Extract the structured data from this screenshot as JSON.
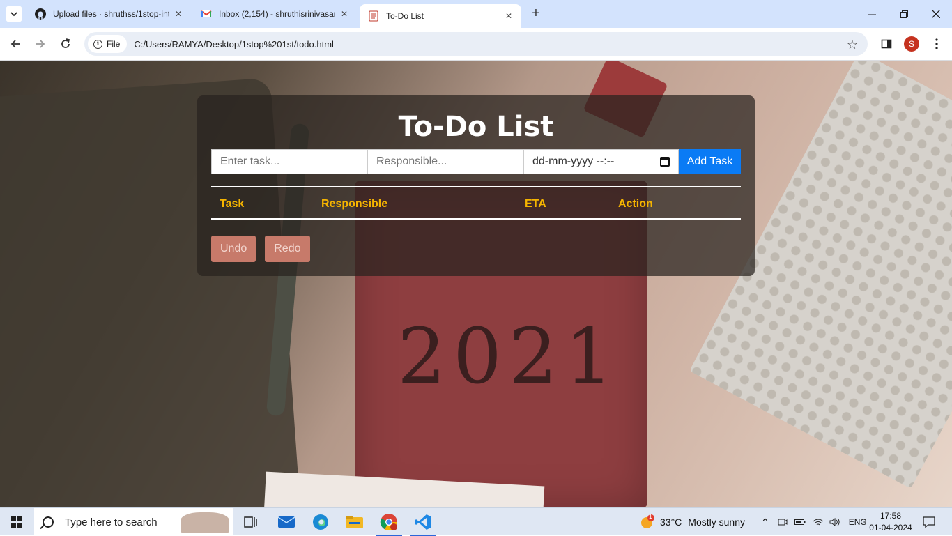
{
  "browser": {
    "tabs": [
      {
        "title": "Upload files · shruthss/1stop-int",
        "icon": "github-icon",
        "active": false
      },
      {
        "title": "Inbox (2,154) - shruthisrinivasan",
        "icon": "gmail-icon",
        "active": false
      },
      {
        "title": "To-Do List",
        "icon": "page-icon",
        "active": true
      }
    ],
    "address_chip": "File",
    "url": "C:/Users/RAMYA/Desktop/1stop%201st/todo.html",
    "profile_initial": "S"
  },
  "page": {
    "title": "To-Do List",
    "task_placeholder": "Enter task...",
    "responsible_placeholder": "Responsible...",
    "eta_placeholder": "dd-mm-yyyy --:--",
    "add_button": "Add Task",
    "columns": [
      "Task",
      "Responsible",
      "ETA",
      "Action"
    ],
    "undo_button": "Undo",
    "redo_button": "Redo",
    "background_year": "2021"
  },
  "taskbar": {
    "search_placeholder": "Type here to search",
    "weather_temp": "33°C",
    "weather_text": "Mostly sunny",
    "weather_badge": "1",
    "language": "ENG",
    "time": "17:58",
    "date": "01-04-2024"
  },
  "colors": {
    "accent_blue": "#0a7bf5",
    "header_yellow": "#f5b400",
    "undo_redo": "#c77a6a"
  }
}
